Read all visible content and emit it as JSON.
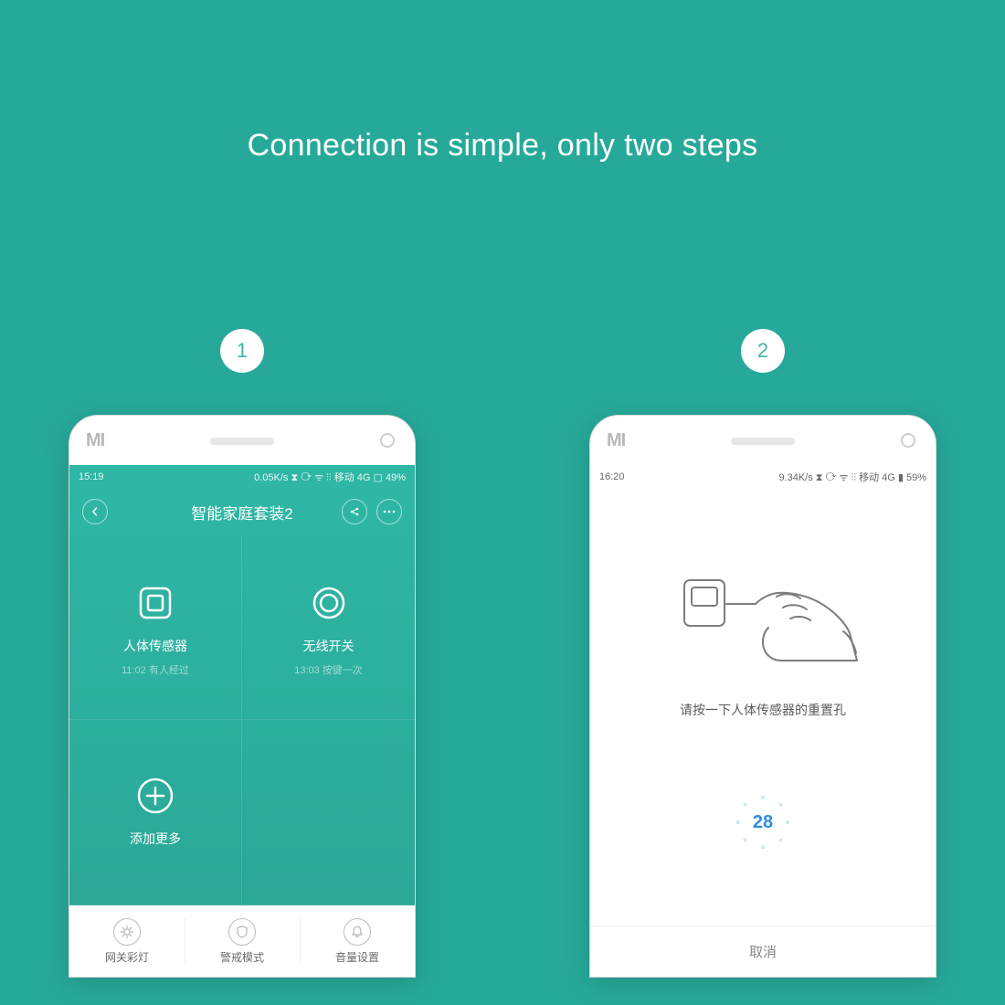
{
  "headline": "Connection is simple, only two steps",
  "steps": {
    "one": "1",
    "two": "2"
  },
  "phone1": {
    "status": {
      "time": "15:19",
      "right": "0.05K/s  ⧗  ⟳  ᯤ  ⫶⫶ 移动 4G ▢ 49%"
    },
    "header": {
      "title": "智能家庭套装2"
    },
    "devices": [
      {
        "label": "人体传感器",
        "sub": "11:02  有人经过"
      },
      {
        "label": "无线开关",
        "sub": "13:03  按键一次"
      },
      {
        "label": "添加更多",
        "sub": ""
      }
    ],
    "bottom": [
      {
        "label": "网关彩灯"
      },
      {
        "label": "警戒模式"
      },
      {
        "label": "音量设置"
      }
    ]
  },
  "phone2": {
    "status": {
      "time": "16:20",
      "right": "9.34K/s  ⧗  ⟳  ᯤ  ⫶⫶ 移动 4G ▮ 59%"
    },
    "hint": "请按一下人体传感器的重置孔",
    "countdown": "28",
    "cancel": "取消"
  }
}
